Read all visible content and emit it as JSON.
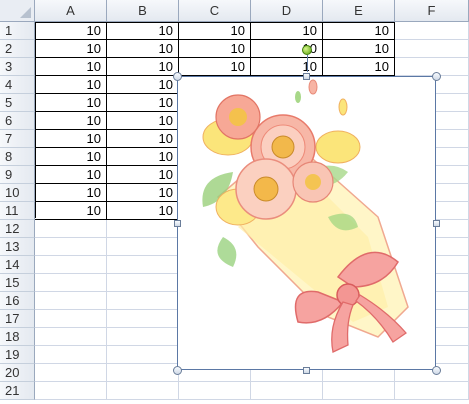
{
  "columns": [
    "A",
    "B",
    "C",
    "D",
    "E",
    "F"
  ],
  "rows": [
    "1",
    "2",
    "3",
    "4",
    "5",
    "6",
    "7",
    "8",
    "9",
    "10",
    "11",
    "12",
    "13",
    "14",
    "15",
    "16",
    "17",
    "18",
    "19",
    "20",
    "21"
  ],
  "cell_value": "10",
  "picture": {
    "description_icon": "flower-bouquet-icon"
  },
  "colors": {
    "grid": "#d0d7e5",
    "header_bg": "#e4e9f0",
    "selection_border": "#5b78a5",
    "rotate_handle": "#5aa20e"
  }
}
